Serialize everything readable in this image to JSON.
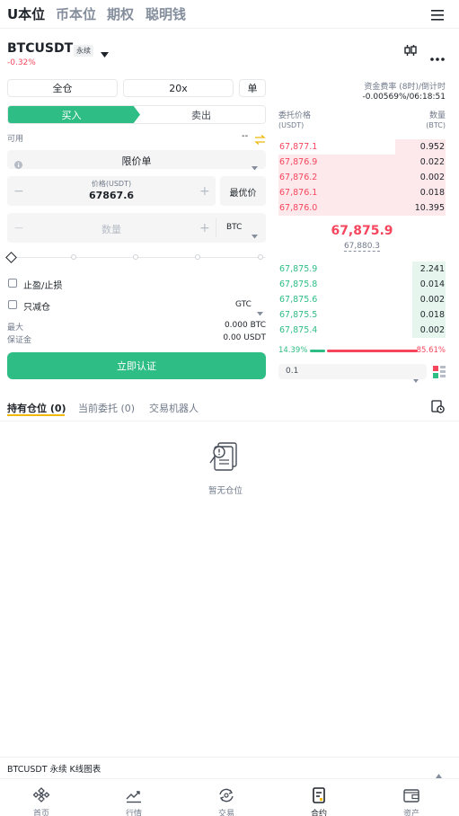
{
  "top_tabs": [
    "U本位",
    "币本位",
    "期权",
    "聪明钱"
  ],
  "header": {
    "symbol": "BTCUSDT",
    "perp_badge": "永续",
    "change": "-0.32%",
    "funding_label": "资金费率 (8时)/倒计时",
    "funding_value": "-0.00569%/06:18:51"
  },
  "order": {
    "margin_mode": "全仓",
    "leverage": "20x",
    "position_mode": "单",
    "buy_label": "买入",
    "sell_label": "卖出",
    "available_label": "可用",
    "available_value": "--",
    "order_type": "限价单",
    "price_label": "价格(USDT)",
    "price_value": "67867.6",
    "best_price_label": "最优价",
    "qty_placeholder": "数量",
    "qty_unit": "BTC",
    "tp_sl_label": "止盈/止损",
    "reduce_only_label": "只减仓",
    "tif": "GTC",
    "max_label": "最大",
    "max_value": "0.000 BTC",
    "margin_label": "保证金",
    "margin_value": "0.00 USDT",
    "submit_label": "立即认证"
  },
  "orderbook": {
    "price_header": "委托价格",
    "price_unit": "(USDT)",
    "qty_header": "数量",
    "qty_unit": "(BTC)",
    "asks": [
      {
        "price": "67,877.1",
        "qty": "0.952",
        "depth": 0.3
      },
      {
        "price": "67,876.9",
        "qty": "0.022",
        "depth": 1.0
      },
      {
        "price": "67,876.2",
        "qty": "0.002",
        "depth": 1.0
      },
      {
        "price": "67,876.1",
        "qty": "0.018",
        "depth": 1.0
      },
      {
        "price": "67,876.0",
        "qty": "10.395",
        "depth": 1.0
      }
    ],
    "last_price": "67,875.9",
    "mark_price": "67,880.3",
    "bids": [
      {
        "price": "67,875.9",
        "qty": "2.241",
        "depth": 0.2
      },
      {
        "price": "67,875.8",
        "qty": "0.014",
        "depth": 0.2
      },
      {
        "price": "67,875.6",
        "qty": "0.002",
        "depth": 0.2
      },
      {
        "price": "67,875.5",
        "qty": "0.018",
        "depth": 0.2
      },
      {
        "price": "67,875.4",
        "qty": "0.002",
        "depth": 0.2
      }
    ],
    "buy_ratio": "14.39%",
    "sell_ratio": "85.61%",
    "buy_ratio_value": 0.1439,
    "precision": "0.1"
  },
  "positions": {
    "tabs": [
      "持有仓位 (0)",
      "当前委托 (0)",
      "交易机器人"
    ],
    "empty_text": "暂无仓位"
  },
  "kline_bar": "BTCUSDT 永续 K线图表",
  "bottom_nav": [
    "首页",
    "行情",
    "交易",
    "合约",
    "资产"
  ],
  "colors": {
    "green": "#2ebd85",
    "red": "#f6465d",
    "accent": "#f0b90b"
  }
}
